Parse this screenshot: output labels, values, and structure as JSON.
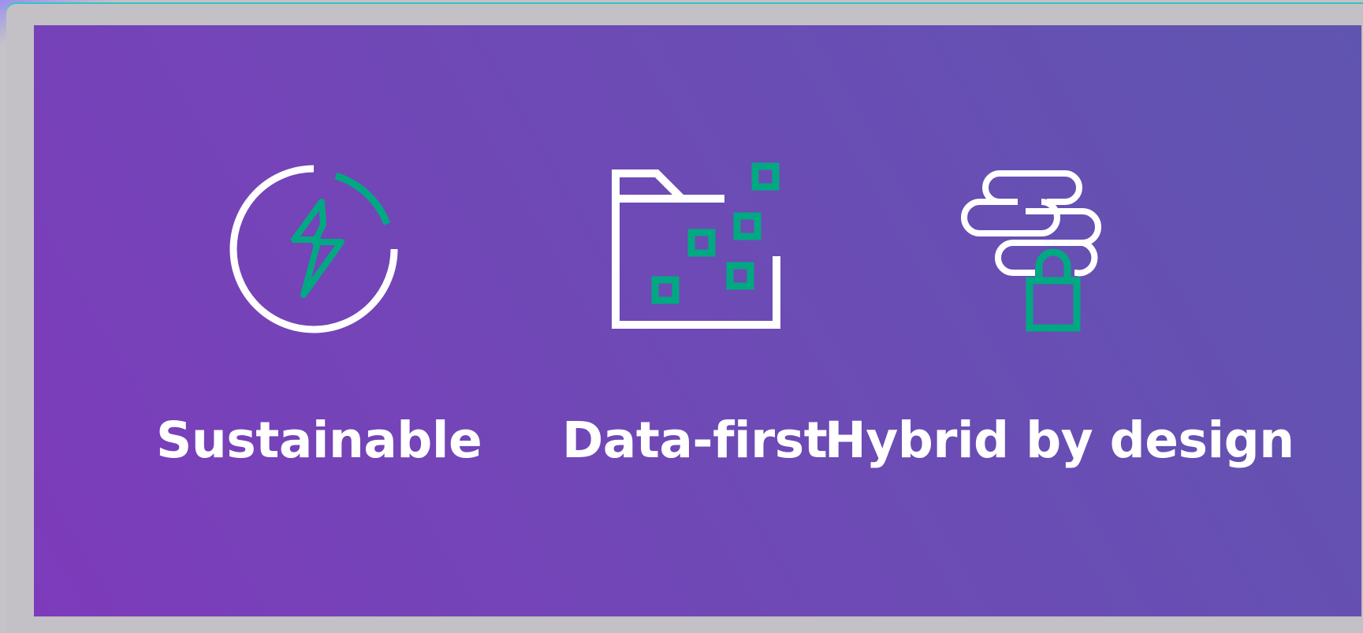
{
  "features": [
    {
      "label": "Sustainable",
      "icon": "power-ring-icon"
    },
    {
      "label": "Data-first",
      "icon": "folder-data-icon"
    },
    {
      "label": "Hybrid by design",
      "icon": "cloud-lock-icon"
    }
  ],
  "colors": {
    "accent": "#01a982",
    "stroke": "#ffffff",
    "panel_start": "#7d3bbb",
    "panel_end": "#5f55b0"
  }
}
